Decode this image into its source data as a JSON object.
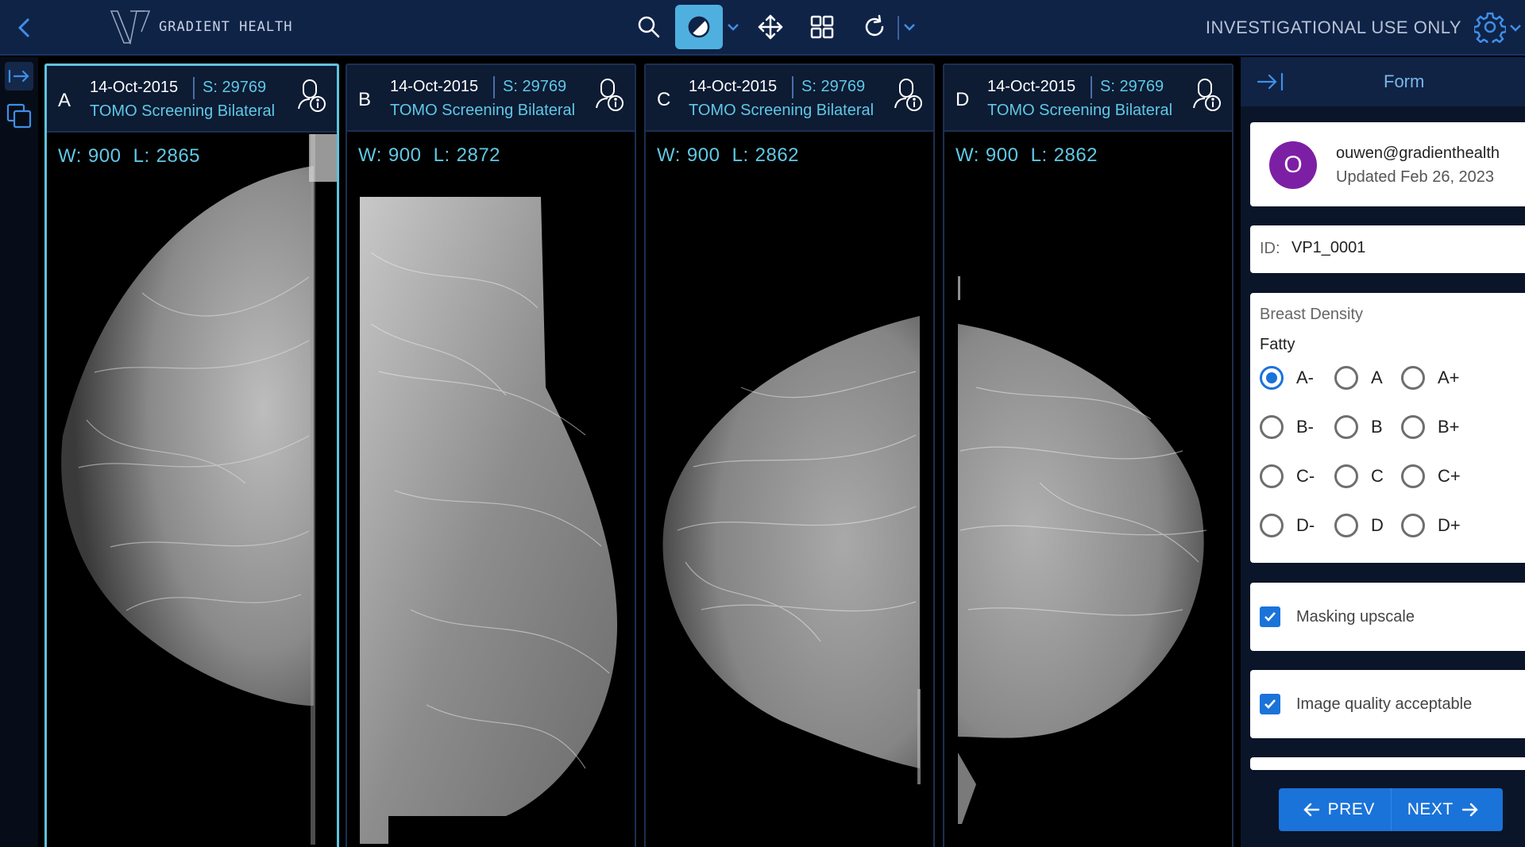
{
  "app": {
    "brand": "GRADIENT HEALTH",
    "notice": "INVESTIGATIONAL USE ONLY",
    "accent": "#5fc3dd",
    "primary": "#1a73d9",
    "topbar_bg": "#0f2347"
  },
  "toolbar": {
    "tools": [
      "search-icon",
      "contrast-icon",
      "move-icon",
      "layout-grid-icon",
      "rotate-icon"
    ],
    "active_tool": "contrast"
  },
  "viewports": [
    {
      "letter": "A",
      "date": "14-Oct-2015",
      "series": "S: 29769",
      "description": "TOMO Screening Bilateral",
      "w_label": "W:",
      "w": "900",
      "l_label": "L:",
      "l": "2865",
      "selected": true
    },
    {
      "letter": "B",
      "date": "14-Oct-2015",
      "series": "S: 29769",
      "description": "TOMO Screening Bilateral",
      "w_label": "W:",
      "w": "900",
      "l_label": "L:",
      "l": "2872",
      "selected": false
    },
    {
      "letter": "C",
      "date": "14-Oct-2015",
      "series": "S: 29769",
      "description": "TOMO Screening Bilateral",
      "w_label": "W:",
      "w": "900",
      "l_label": "L:",
      "l": "2862",
      "selected": false
    },
    {
      "letter": "D",
      "date": "14-Oct-2015",
      "series": "S: 29769",
      "description": "TOMO Screening Bilateral",
      "w_label": "W:",
      "w": "900",
      "l_label": "L:",
      "l": "2862",
      "selected": false
    }
  ],
  "panel": {
    "title": "Form",
    "user": {
      "initial": "O",
      "email": "ouwen@gradienthealth",
      "updated": "Updated Feb 26, 2023",
      "avatar_color": "#7d1fa4"
    },
    "id": {
      "label": "ID:",
      "value": "VP1_0001"
    },
    "density": {
      "title": "Breast Density",
      "value": "Fatty",
      "options": [
        [
          "A-",
          "A",
          "A+"
        ],
        [
          "B-",
          "B",
          "B+"
        ],
        [
          "C-",
          "C",
          "C+"
        ],
        [
          "D-",
          "D",
          "D+"
        ]
      ],
      "selected": "A-"
    },
    "checks": [
      {
        "label": "Masking upscale",
        "checked": true
      },
      {
        "label": "Image quality acceptable",
        "checked": true
      }
    ],
    "prev_label": "PREV",
    "next_label": "NEXT"
  }
}
